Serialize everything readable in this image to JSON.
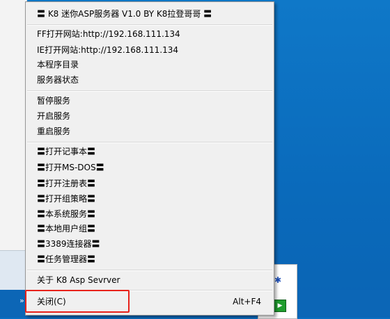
{
  "menu": {
    "title": "〓 K8 迷你ASP服务器 V1.0  BY K8拉登哥哥 〓",
    "group1": [
      {
        "label": "FF打开网站:http://192.168.111.134"
      },
      {
        "label": "IE打开网站:http://192.168.111.134"
      },
      {
        "label": "本程序目录"
      },
      {
        "label": "服务器状态"
      }
    ],
    "group2": [
      {
        "label": "暂停服务"
      },
      {
        "label": "开启服务"
      },
      {
        "label": "重启服务"
      }
    ],
    "group3": [
      {
        "label": "〓打开记事本〓"
      },
      {
        "label": "〓打开MS-DOS〓"
      },
      {
        "label": "〓打开注册表〓"
      },
      {
        "label": "〓打开组策略〓"
      },
      {
        "label": "〓本系统服务〓"
      },
      {
        "label": "〓本地用户组〓"
      },
      {
        "label": "〓3389连接器〓"
      },
      {
        "label": "〓任务管理器〓"
      }
    ],
    "about": {
      "label": "关于 K8 Asp Sevrver"
    },
    "close": {
      "label": "关闭(C)",
      "shortcut": "Alt+F4"
    }
  },
  "tray": {
    "icons": [
      "bluetooth-icon",
      "green-app-icon"
    ]
  },
  "colors": {
    "desktop": "#0a6fc2",
    "menu_bg": "#f0f0f0",
    "highlight": "#e8221b"
  }
}
